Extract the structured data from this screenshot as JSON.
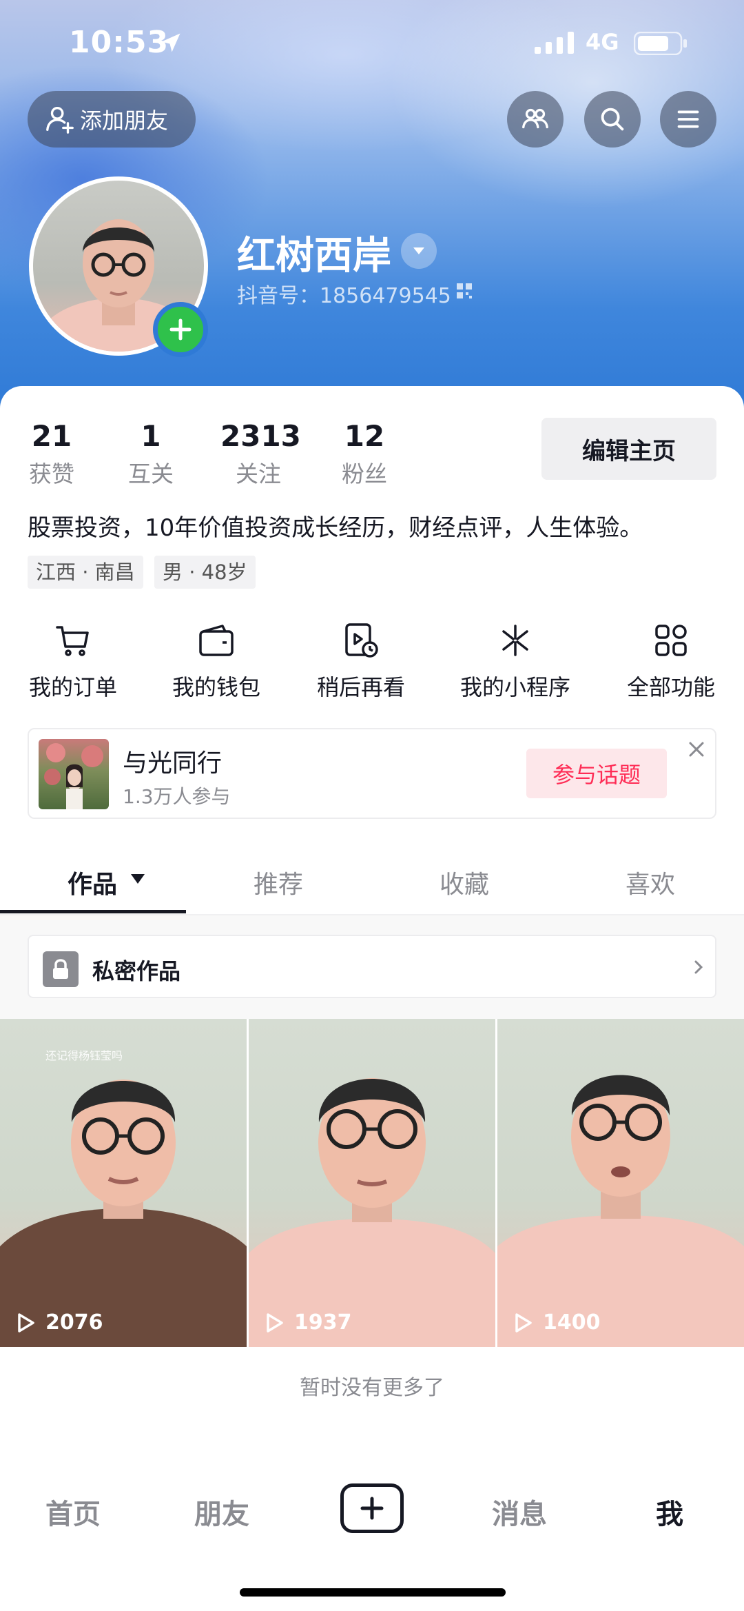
{
  "status": {
    "time": "10:53",
    "network": "4G"
  },
  "header": {
    "add_friend": "添加朋友"
  },
  "profile": {
    "nickname": "红树西岸",
    "douyin_id": "抖音号：1856479545"
  },
  "stats": [
    {
      "num": "21",
      "label": "获赞"
    },
    {
      "num": "1",
      "label": "互关"
    },
    {
      "num": "2313",
      "label": "关注"
    },
    {
      "num": "12",
      "label": "粉丝"
    }
  ],
  "edit_button": "编辑主页",
  "bio": "股票投资，10年价值投资成长经历，财经点评，人生体验。",
  "tags": [
    "江西 · 南昌",
    "男 · 48岁"
  ],
  "functions": [
    {
      "label": "我的订单",
      "icon": "cart-icon"
    },
    {
      "label": "我的钱包",
      "icon": "wallet-icon"
    },
    {
      "label": "稍后再看",
      "icon": "watch-later-icon"
    },
    {
      "label": "我的小程序",
      "icon": "mini-program-icon"
    },
    {
      "label": "全部功能",
      "icon": "all-functions-icon"
    }
  ],
  "topic": {
    "title": "与光同行",
    "subtitle": "1.3万人参与",
    "button": "参与话题"
  },
  "tabs": [
    "作品",
    "推荐",
    "收藏",
    "喜欢"
  ],
  "private_works": "私密作品",
  "videos": [
    {
      "plays": "2076",
      "caption": "还记得杨钰莹吗"
    },
    {
      "plays": "1937"
    },
    {
      "plays": "1400"
    }
  ],
  "no_more": "暂时没有更多了",
  "nav": [
    "首页",
    "朋友",
    "消息",
    "我"
  ]
}
